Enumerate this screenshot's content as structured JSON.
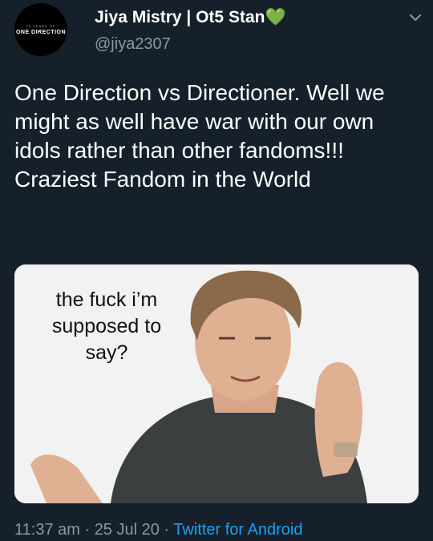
{
  "author": {
    "display_name": "Jiya Mistry | Ot5 Stan💚",
    "handle": "@jiya2307",
    "avatar_text_small": "10 YEARS OF",
    "avatar_text_big": "ONE DIRECTION"
  },
  "tweet": {
    "text": "One Direction vs Directioner. Well we might as well have war with our own idols rather than other fandoms!!! Craziest Fandom in the World"
  },
  "media": {
    "caption": "the fuck i’m supposed to say?"
  },
  "meta": {
    "time": "11:37 am",
    "separator": " · ",
    "date": "25 Jul 20",
    "source": "Twitter for Android"
  },
  "colors": {
    "background": "#15202b",
    "secondary_text": "#8899a6",
    "link": "#1da1f2"
  }
}
